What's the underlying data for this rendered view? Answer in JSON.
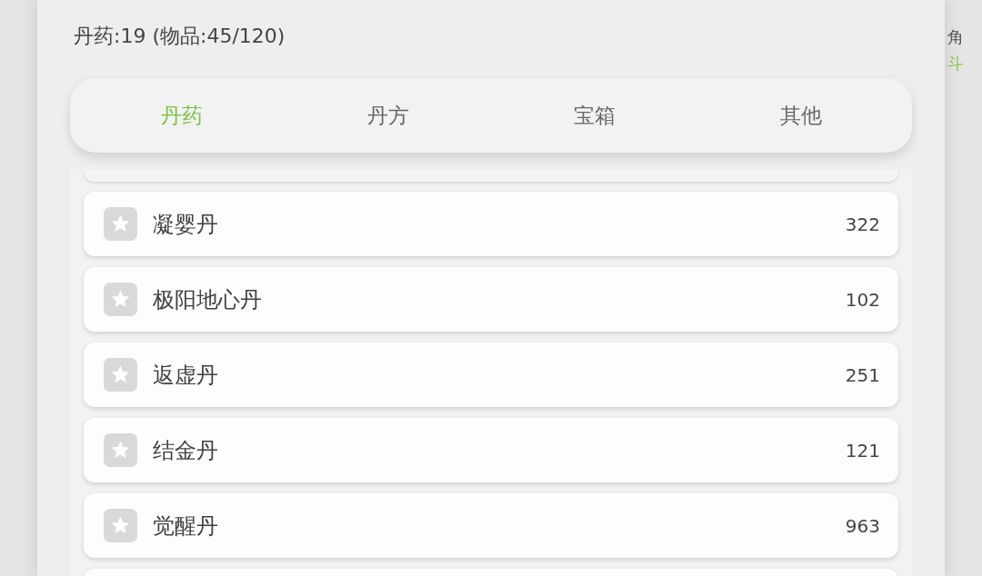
{
  "background": {
    "texts": [
      {
        "text": "角",
        "color": "#555555"
      },
      {
        "text": "斗",
        "color": "#8bc34a"
      }
    ]
  },
  "panel": {
    "summary": "丹药:19 (物品:45/120)",
    "tabs": [
      {
        "label": "丹药",
        "selected": true
      },
      {
        "label": "丹方",
        "selected": false
      },
      {
        "label": "宝箱",
        "selected": false
      },
      {
        "label": "其他",
        "selected": false
      }
    ],
    "items": [
      {
        "name": "凝婴丹",
        "count": "322"
      },
      {
        "name": "极阳地心丹",
        "count": "102"
      },
      {
        "name": "返虚丹",
        "count": "251"
      },
      {
        "name": "结金丹",
        "count": "121"
      },
      {
        "name": "觉醒丹",
        "count": "963"
      }
    ]
  }
}
